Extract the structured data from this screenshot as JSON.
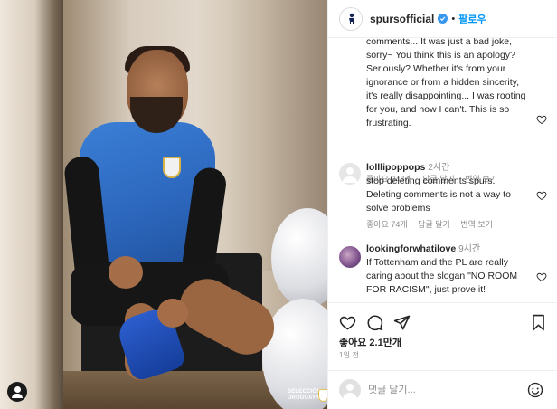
{
  "header": {
    "username": "spursofficial",
    "separator": "•",
    "follow_label": "팔로우"
  },
  "comments": [
    {
      "username": "",
      "time": "",
      "text": "comments... It was just a bad joke, sorry~ You think this is an apology? Seriously? Whether it's from your ignorance or from a hidden sincerity, it's really disappointing... I was rooting for you, and now I can't. This is so frustrating.",
      "likes_label": "좋아요 348개",
      "reply_label": "답글 달기",
      "translate_label": "번역 보기"
    },
    {
      "username": "lolllipoppops",
      "time": "2시간",
      "text": "stop deleting comments spurs. Deleting comments is not a way to solve problems",
      "likes_label": "좋아요 74개",
      "reply_label": "답글 달기",
      "translate_label": "번역 보기"
    },
    {
      "username": "lookingforwhatilove",
      "time": "9시간",
      "text": "If Tottenham and the PL are really caring about the slogan \"NO ROOM FOR RACISM\", just prove it!"
    }
  ],
  "post": {
    "likes": "좋아요 2.1만개",
    "time_ago": "1일 전"
  },
  "add_comment": {
    "placeholder": "댓글 달기..."
  },
  "photo": {
    "watermark_line1": "SELECCIÓN",
    "watermark_line2": "URUGUAYA"
  },
  "colors": {
    "accent": "#0095f6",
    "verified": "#3897f0",
    "text": "#262626",
    "muted": "#8e8e8e",
    "border": "#efefef"
  },
  "icons": [
    "heart-icon",
    "comment-icon",
    "share-icon",
    "bookmark-icon",
    "emoji-icon",
    "verified-icon",
    "spurs-logo-icon",
    "avatar-icon"
  ]
}
